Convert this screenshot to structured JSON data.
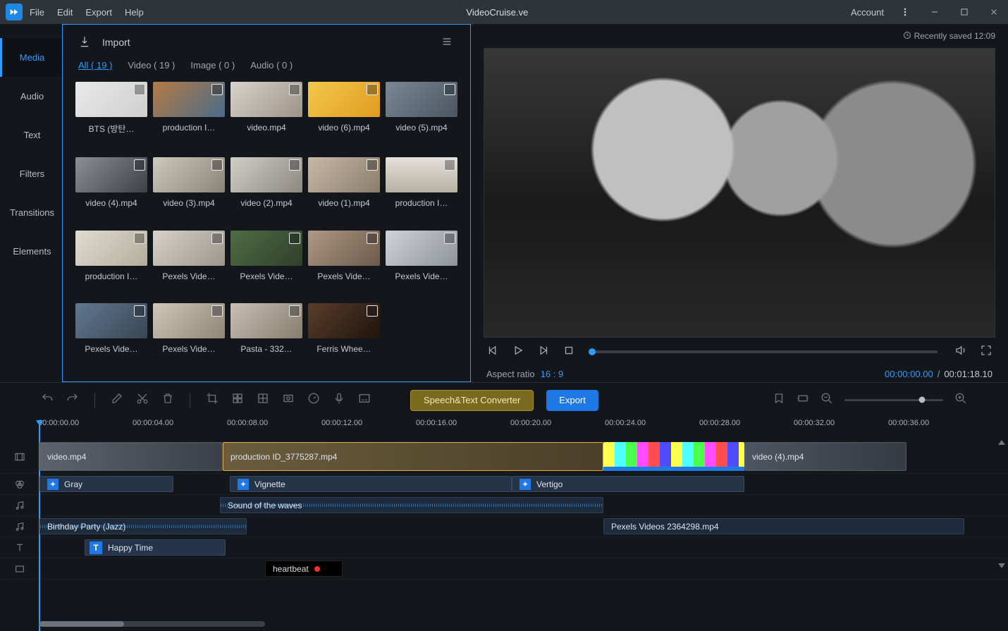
{
  "app": {
    "title": "VideoCruise.ve"
  },
  "menubar": {
    "file": "File",
    "edit": "Edit",
    "export": "Export",
    "help": "Help",
    "account": "Account"
  },
  "sidebar": {
    "tabs": [
      "Media",
      "Audio",
      "Text",
      "Filters",
      "Transitions",
      "Elements"
    ],
    "active": "Media"
  },
  "media_panel": {
    "import_label": "Import",
    "filters": {
      "all": "All ( 19 )",
      "video": "Video ( 19 )",
      "image": "Image ( 0 )",
      "audio": "Audio ( 0 )"
    },
    "items": [
      {
        "name": "BTS (방탄…"
      },
      {
        "name": "production I…"
      },
      {
        "name": "video.mp4"
      },
      {
        "name": "video (6).mp4"
      },
      {
        "name": "video (5).mp4"
      },
      {
        "name": "video (4).mp4"
      },
      {
        "name": "video (3).mp4"
      },
      {
        "name": "video (2).mp4"
      },
      {
        "name": "video (1).mp4"
      },
      {
        "name": "production I…"
      },
      {
        "name": "production I…"
      },
      {
        "name": "Pexels Vide…"
      },
      {
        "name": "Pexels Vide…"
      },
      {
        "name": "Pexels Vide…"
      },
      {
        "name": "Pexels Vide…"
      },
      {
        "name": "Pexels Vide…"
      },
      {
        "name": "Pexels Vide…"
      },
      {
        "name": "Pasta - 332…"
      },
      {
        "name": "Ferris Whee…"
      }
    ]
  },
  "preview": {
    "saved_label": "Recently saved 12:09",
    "aspect_label": "Aspect ratio",
    "aspect_value": "16 : 9",
    "current_time": "00:00:00.00",
    "duration": "00:01:18.10"
  },
  "toolbar": {
    "speech_label": "Speech&Text Converter",
    "export_label": "Export"
  },
  "timeline": {
    "ruler": [
      "00:00:00.00",
      "00:00:04.00",
      "00:00:08.00",
      "00:00:12.00",
      "00:00:16.00",
      "00:00:20.00",
      "00:00:24.00",
      "00:00:28.00",
      "00:00:32.00",
      "00:00:36.00"
    ],
    "video_clips": [
      {
        "label": "video.mp4"
      },
      {
        "label": "production ID_3775287.mp4"
      },
      {
        "label": "video (4).mp4"
      }
    ],
    "filter_clips": [
      {
        "label": "Gray"
      },
      {
        "label": "Vignette"
      },
      {
        "label": "Vertigo"
      }
    ],
    "sfx_clip": {
      "label": "Sound of the waves"
    },
    "music_clips": [
      {
        "label": "Birthday Party (Jazz)"
      },
      {
        "label": "Pexels Videos 2364298.mp4"
      }
    ],
    "text_clip": {
      "label": "Happy Time"
    },
    "rec_clip": {
      "label": "heartbeat"
    }
  }
}
